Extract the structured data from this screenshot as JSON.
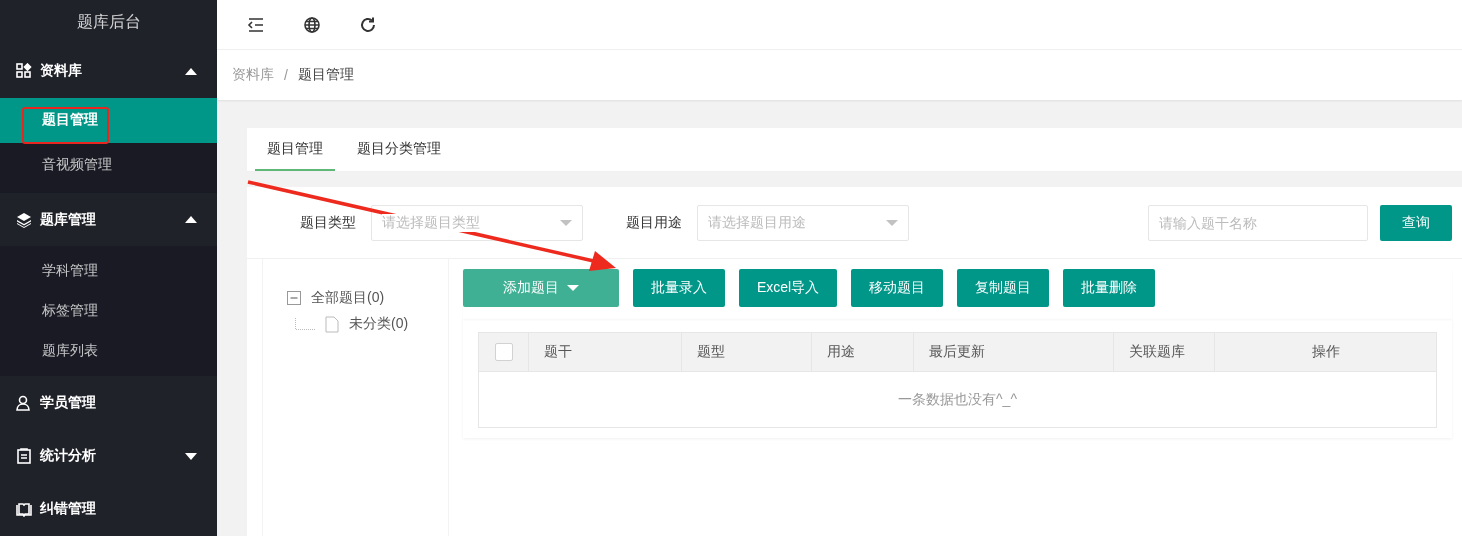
{
  "sidebar": {
    "title": "题库后台",
    "groups": [
      {
        "label": "资料库",
        "expanded": true,
        "children": [
          {
            "label": "题目管理",
            "selected": true
          },
          {
            "label": "音视频管理",
            "selected": false
          }
        ]
      },
      {
        "label": "题库管理",
        "expanded": true,
        "children": [
          {
            "label": "学科管理",
            "selected": false
          },
          {
            "label": "标签管理",
            "selected": false
          },
          {
            "label": "题库列表",
            "selected": false
          }
        ]
      },
      {
        "label": "学员管理"
      },
      {
        "label": "统计分析",
        "expanded": false
      },
      {
        "label": "纠错管理"
      }
    ]
  },
  "breadcrumb": {
    "items": [
      "资料库",
      "题目管理"
    ],
    "separator": "/"
  },
  "tabs": [
    {
      "label": "题目管理",
      "selected": true
    },
    {
      "label": "题目分类管理",
      "selected": false
    }
  ],
  "filters": [
    {
      "label": "题目类型",
      "placeholder": "请选择题目类型"
    },
    {
      "label": "题目用途",
      "placeholder": "请选择题目用途"
    }
  ],
  "search": {
    "placeholder": "请输入题干名称",
    "button": "查询"
  },
  "tree": [
    {
      "label": "全部题目(0)",
      "expanded": true,
      "children": [
        {
          "label": "未分类(0)"
        }
      ]
    }
  ],
  "actions": [
    {
      "label": "添加题目",
      "kind": "dropdown"
    },
    {
      "label": "批量录入",
      "kind": "primary"
    },
    {
      "label": "Excel导入",
      "kind": "primary"
    },
    {
      "label": "移动题目",
      "kind": "primary"
    },
    {
      "label": "复制题目",
      "kind": "primary"
    },
    {
      "label": "批量删除",
      "kind": "primary"
    }
  ],
  "table": {
    "select_all_checked": false,
    "columns": [
      "题干",
      "题型",
      "用途",
      "最后更新",
      "关联题库",
      "操作"
    ],
    "empty_text": "一条数据也没有^_^"
  }
}
